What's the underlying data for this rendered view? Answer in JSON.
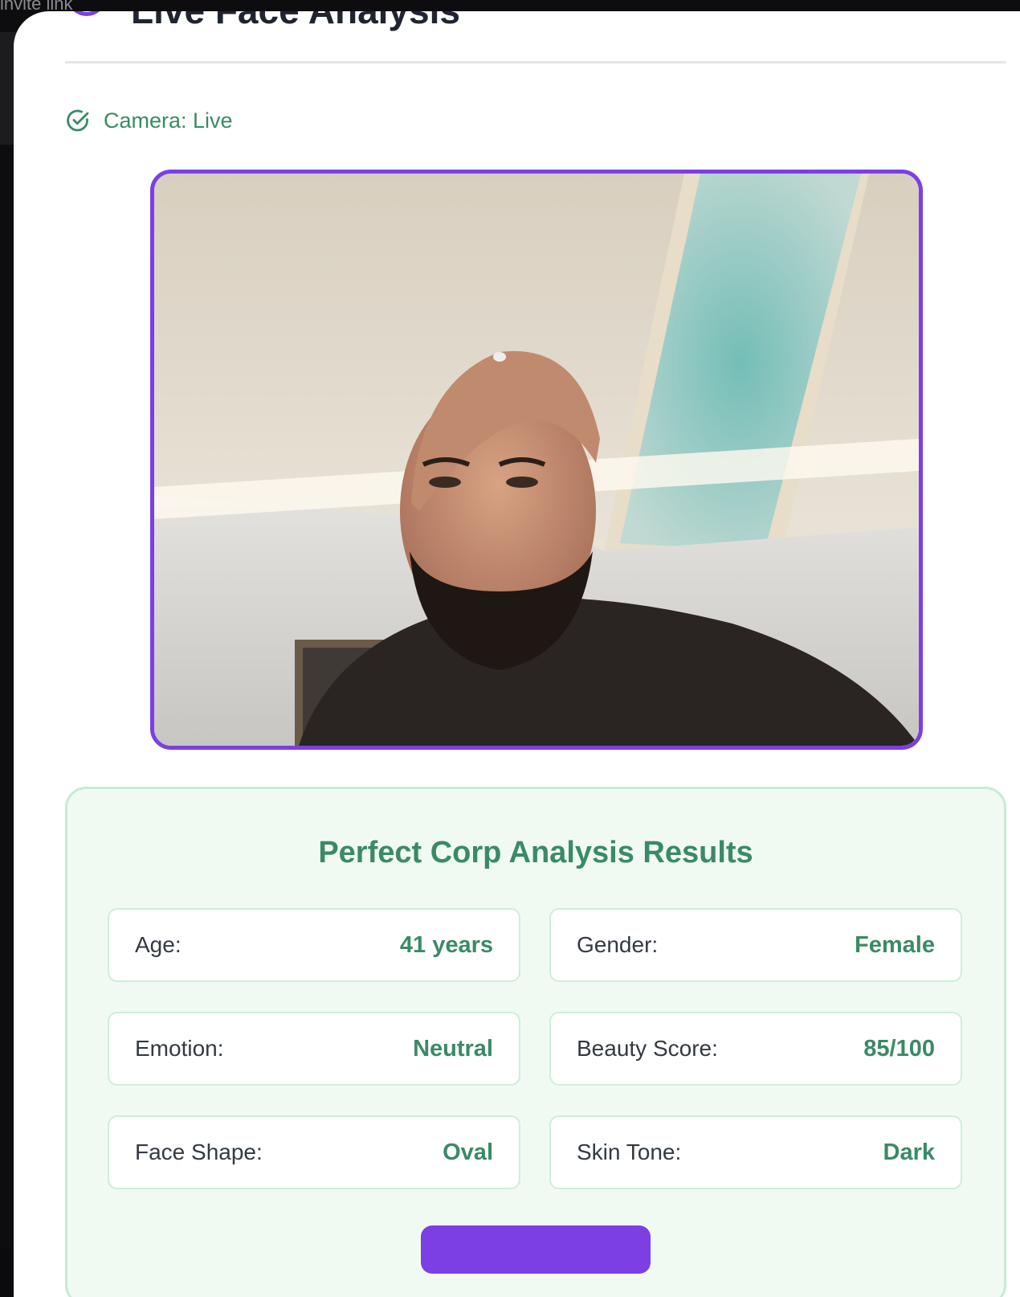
{
  "backdrop": {
    "partial_text": "invite link"
  },
  "modal": {
    "title": "Live Face Analysis",
    "header_icon": "circle-icon",
    "close_icon": "close-icon"
  },
  "camera": {
    "status_icon": "check-circle-icon",
    "status_label": "Camera: Live"
  },
  "results": {
    "title": "Perfect Corp Analysis Results",
    "items": [
      {
        "label": "Age:",
        "value": "41 years"
      },
      {
        "label": "Gender:",
        "value": "Female"
      },
      {
        "label": "Emotion:",
        "value": "Neutral"
      },
      {
        "label": "Beauty Score:",
        "value": "85/100"
      },
      {
        "label": "Face Shape:",
        "value": "Oval"
      },
      {
        "label": "Skin Tone:",
        "value": "Dark"
      }
    ],
    "action_button_label": ""
  },
  "colors": {
    "accent": "#7b3fe4",
    "success_text": "#3a8a66",
    "results_background": "#f0faf3",
    "results_border": "#c4ecd2"
  }
}
